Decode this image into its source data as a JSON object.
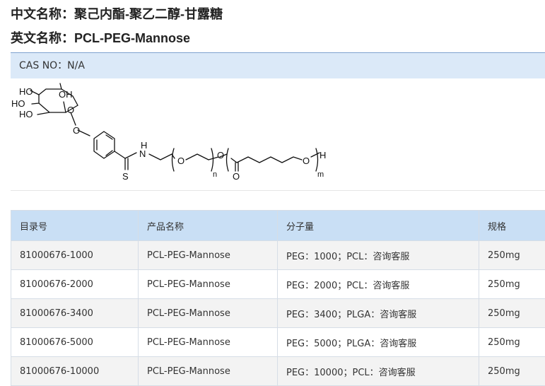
{
  "header": {
    "cn_label": "中文名称：",
    "cn_value": "聚己内酯-聚乙二醇-甘露糖",
    "en_label": "英文名称：",
    "en_value": "PCL-PEG-Mannose",
    "cas": "CAS NO：N/A"
  },
  "structure": {
    "labels": {
      "ho1": "HO",
      "oh": "OH",
      "ho2": "HO",
      "ho3": "HO",
      "o_ring": "O",
      "o_link": "O",
      "n": "N",
      "h_n": "H",
      "s": "S",
      "o_peg": "O",
      "n_sub": "n",
      "o_ester": "O",
      "o_carbonyl": "O",
      "o_term": "O",
      "h_term": "H",
      "m_sub": "m"
    }
  },
  "table": {
    "headers": [
      "目录号",
      "产品名称",
      "分子量",
      "规格"
    ],
    "rows": [
      [
        "81000676-1000",
        "PCL-PEG-Mannose",
        "PEG：1000；PCL：咨询客服",
        "250mg"
      ],
      [
        "81000676-2000",
        "PCL-PEG-Mannose",
        "PEG：2000；PCL：咨询客服",
        "250mg"
      ],
      [
        "81000676-3400",
        "PCL-PEG-Mannose",
        "PEG：3400；PLGA：咨询客服",
        "250mg"
      ],
      [
        "81000676-5000",
        "PCL-PEG-Mannose",
        "PEG：5000；PLGA：咨询客服",
        "250mg"
      ],
      [
        "81000676-10000",
        "PCL-PEG-Mannose",
        "PEG：10000；PCL：咨询客服",
        "250mg"
      ]
    ]
  },
  "colors": {
    "cas_bar_bg": "#dbe9f8",
    "table_header_bg": "#c9dff5",
    "row_alt_bg": "#f3f3f3"
  }
}
